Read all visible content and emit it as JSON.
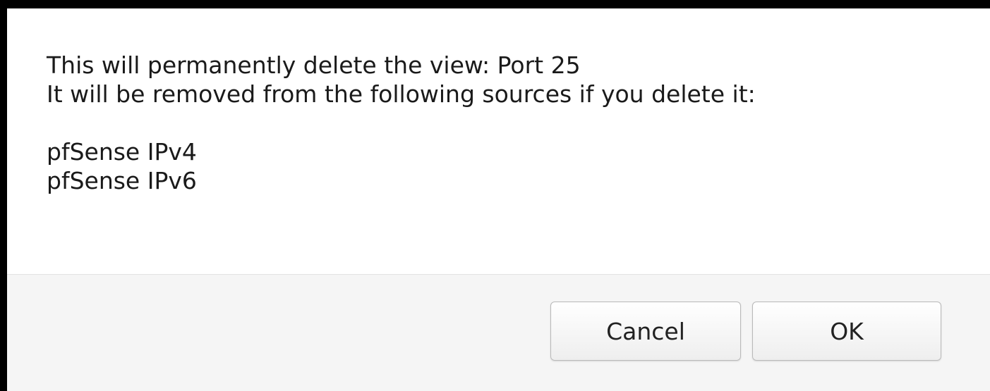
{
  "dialog": {
    "message_lines": [
      "This will permanently delete the view: Port 25",
      "It will be removed from the following sources if you delete it:"
    ],
    "sources": [
      "pfSense IPv4",
      "pfSense IPv6"
    ],
    "buttons": {
      "cancel_label": "Cancel",
      "ok_label": "OK"
    }
  },
  "colors": {
    "backdrop": "#000000",
    "dialog_bg": "#ffffff",
    "footer_bg": "#f5f5f5",
    "text": "#1a1a1a"
  }
}
